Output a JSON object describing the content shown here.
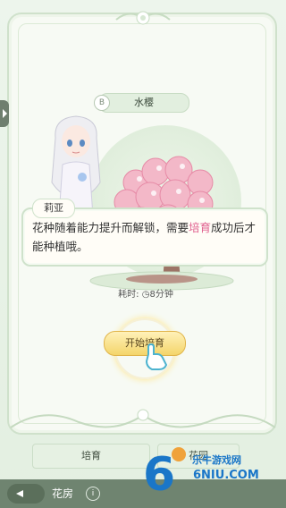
{
  "panel": {
    "badge_letter": "B",
    "flower_name": "水樱"
  },
  "dialog": {
    "speaker": "莉亚",
    "text_before": "花种随着能力提升而解锁，需要",
    "highlight": "培育",
    "text_after": "成功后才能种植哦。"
  },
  "timer": {
    "label": "耗时:",
    "value": "8分钟"
  },
  "start_button": {
    "label": "开始培育"
  },
  "tabs": [
    {
      "label": "培育"
    },
    {
      "label": "花园"
    }
  ],
  "nav": {
    "title": "花房",
    "info": "i"
  },
  "watermark": {
    "line1": "乐牛游戏网",
    "line2": "6NIU.COM"
  },
  "colors": {
    "highlight": "#e0608f",
    "panel_bg": "#f7faf4",
    "nav_bg": "#6f8470",
    "button": "#f4d56a"
  }
}
